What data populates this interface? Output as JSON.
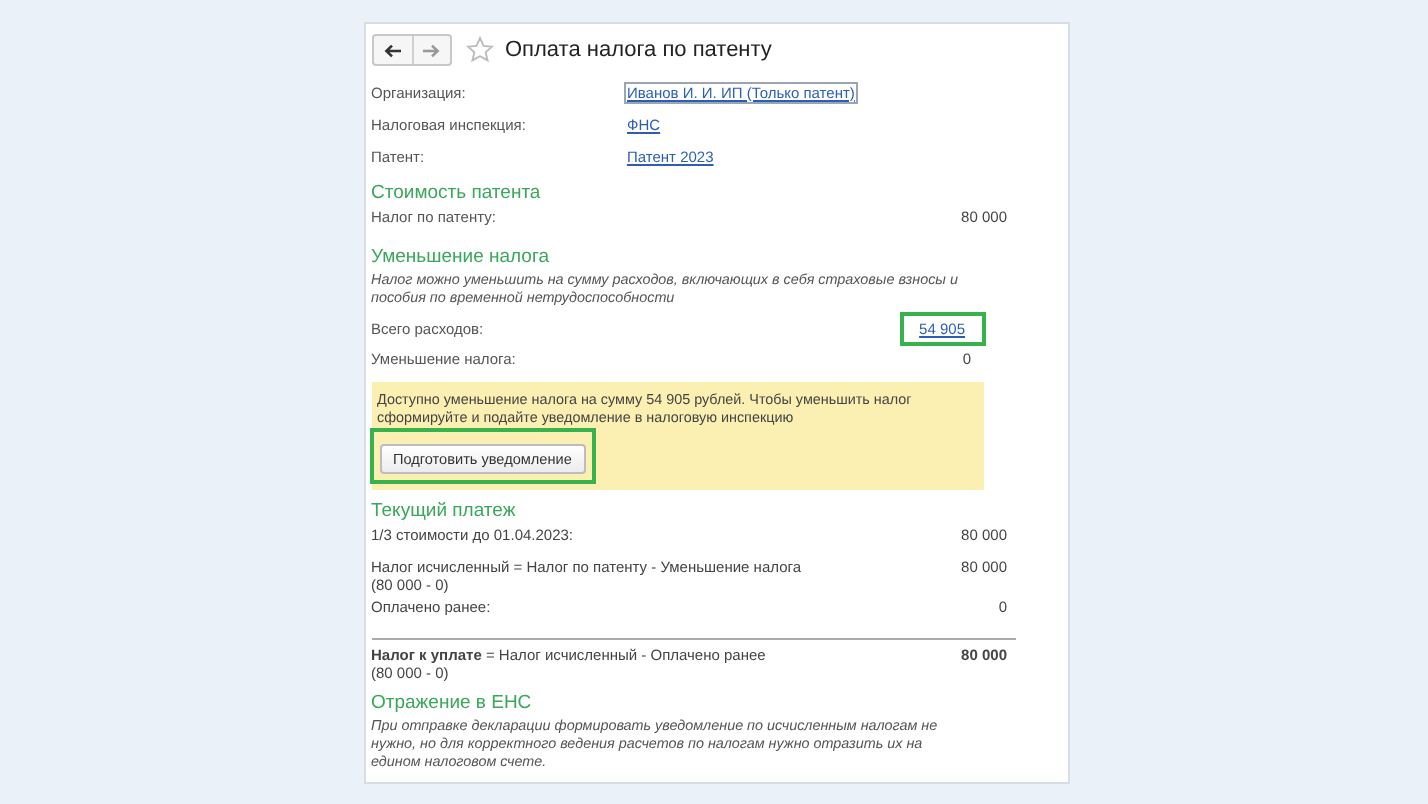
{
  "header": {
    "favorite": false,
    "title": "Оплата налога по патенту"
  },
  "fields": [
    {
      "label": "Организация:",
      "value": "Иванов И. И. ИП (Только патент)",
      "focused": true
    },
    {
      "label": "Налоговая инспекция:",
      "value": "ФНС ",
      "focused": false
    },
    {
      "label": "Патент:",
      "value": "Патент 2023",
      "focused": false
    }
  ],
  "patent_cost": {
    "heading": "Стоимость патента",
    "label": "Налог по патенту:",
    "value": "80 000"
  },
  "reduction": {
    "heading": "Уменьшение налога",
    "note": "Налог можно уменьшить на сумму расходов, включающих в себя страховые взносы и пособия по временной нетрудоспособности",
    "expenses_label": "Всего расходов:",
    "expenses_value": "54 905",
    "expenses_highlighted": true,
    "reduction_label": "Уменьшение налога:",
    "reduction_value": "0",
    "alert": "Доступно уменьшение налога на сумму 54 905 рублей. Чтобы уменьшить налог сформируйте и подайте уведомление в налоговую инспекцию",
    "button": "Подготовить уведомление",
    "button_highlighted": true
  },
  "current_payment": {
    "heading": "Текущий платеж",
    "rows": [
      {
        "label": "1/3 стоимости до 01.04.2023:",
        "value": "80 000"
      },
      {
        "label": "Налог исчисленный = Налог по патенту - Уменьшение налога",
        "detail": "(80 000 - 0)",
        "value": "80 000"
      },
      {
        "label": "Оплачено ранее:",
        "value": "0"
      }
    ],
    "total_label": "**Налог к уплате** = Налог исчисленный - Оплачено ранее",
    "total_detail": "(80 000 - 0)",
    "total_value": "80 000"
  },
  "ens": {
    "heading": "Отражение в ЕНС",
    "note": "При отправке декларации формировать уведомление по исчисленным налогам не нужно, но для корректного ведения расчетов по налогам нужно отразить их на едином налоговом счете."
  }
}
